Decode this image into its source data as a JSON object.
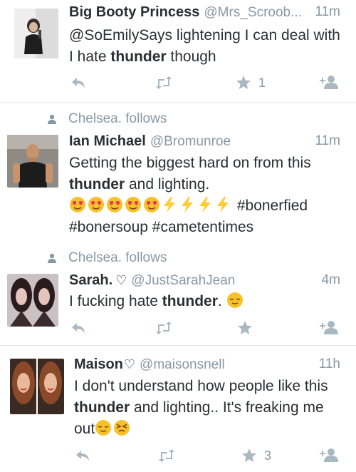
{
  "tweets": [
    {
      "name": "Big Booty Princess",
      "handle": "@Mrs_Scroob...",
      "time": "11m",
      "text_parts": [
        "@SoEmilySays lightening I can deal with I hate ",
        "thunder",
        " though"
      ],
      "favorites": "1",
      "retweets": ""
    },
    {
      "followed_by": "Chelsea. follows",
      "name": "Ian Michael",
      "handle": "@Bromunroe",
      "time": "11m",
      "text_parts": [
        "Getting the biggest hard on from this ",
        "thunder",
        " and lighting."
      ],
      "emoji_line": {
        "heart_eyes_count": 5,
        "lightning_count": 4,
        "hashtag": "#bonerfied"
      },
      "hashtags_line2": "#bonersoup #cametentimes"
    },
    {
      "followed_by": "Chelsea. follows",
      "name": "Sarah.",
      "name_suffix": "♡",
      "handle": "@JustSarahJean",
      "time": "4m",
      "text_parts": [
        "I fucking hate ",
        "thunder",
        ". "
      ],
      "favorites": ""
    },
    {
      "name": "Maison",
      "name_suffix": "♡",
      "handle": "@maisonsnell",
      "time": "11h",
      "text_parts": [
        "I don't understand how people like this ",
        "thunder",
        " and lighting.. It's freaking me out"
      ],
      "favorites": "3"
    }
  ],
  "icons": {
    "reply": "reply-icon",
    "retweet": "retweet-icon",
    "favorite": "star-icon",
    "follow": "follow-user-icon",
    "person": "person-icon",
    "heart_eyes": "heart-eyes-emoji",
    "lightning": "lightning-emoji",
    "relieved": "relieved-emoji",
    "persevere": "persevering-emoji"
  },
  "colors": {
    "text": "#292f33",
    "muted": "#8899a6",
    "icon": "#aab8c2",
    "divider": "#e1e8ed",
    "emoji_yellow": "#f8c12a",
    "lightning": "#ffcc33"
  }
}
